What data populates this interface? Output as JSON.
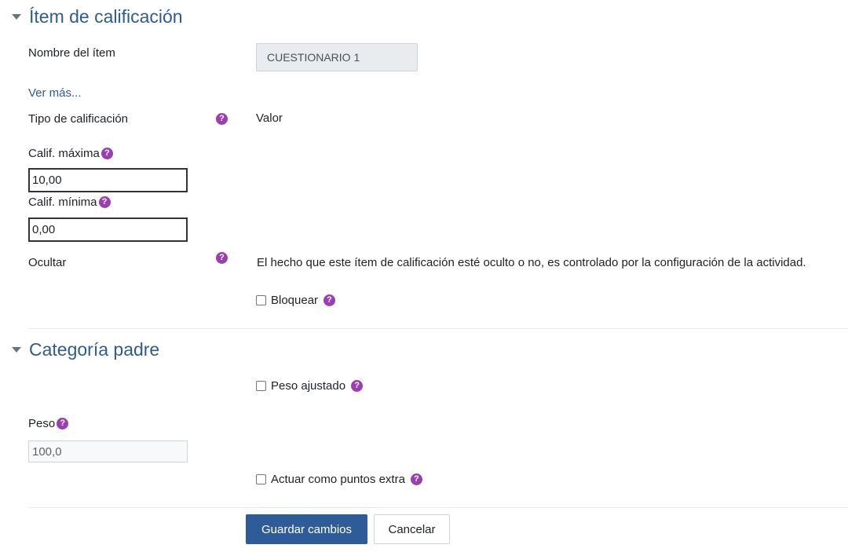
{
  "grade_item_section": {
    "title": "Ítem de calificación",
    "item_name_label": "Nombre del ítem",
    "item_name_value": "CUESTIONARIO 1",
    "show_more_link": "Ver más...",
    "grade_type_label": "Tipo de calificación",
    "grade_type_value": "Valor",
    "max_grade_label": "Calif. máxima",
    "max_grade_value": "10,00",
    "min_grade_label": "Calif. mínima",
    "min_grade_value": "0,00",
    "hidden_label": "Ocultar",
    "hidden_info": "El hecho que este ítem de calificación esté oculto o no, es controlado por la configuración de la actividad.",
    "locked_label": "Bloquear"
  },
  "parent_category_section": {
    "title": "Categoría padre",
    "weight_adjusted_label": "Peso ajustado",
    "weight_label": "Peso",
    "weight_value": "100,0",
    "extra_credit_label": "Actuar como puntos extra"
  },
  "actions": {
    "save_label": "Guardar cambios",
    "cancel_label": "Cancelar"
  },
  "icons": {
    "help": "help-question-icon",
    "collapse": "caret-down-icon"
  },
  "colors": {
    "accent": "#2f5c8d",
    "help_icon": "#9b3fb0",
    "primary_button": "#2f5c99"
  }
}
